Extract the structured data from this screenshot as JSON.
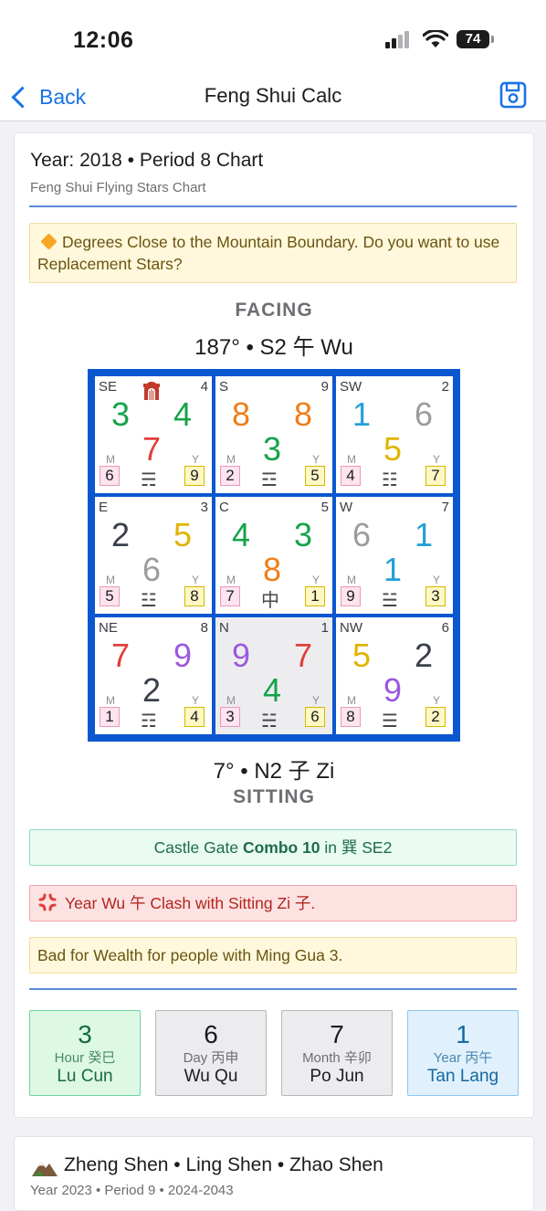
{
  "status": {
    "time": "12:06",
    "battery": "74"
  },
  "nav": {
    "back_label": "Back",
    "title": "Feng Shui Calc"
  },
  "chart": {
    "title": "Year: 2018 • Period 8 Chart",
    "subtitle": "Feng Shui Flying Stars Chart",
    "warning": "Degrees Close to the Mountain Boundary. Do you want to use Replacement Stars?",
    "facing_label": "FACING",
    "facing_direction": "187° • S2 午 Wu",
    "sitting_direction": "7° • N2 子 Zi",
    "sitting_label": "SITTING",
    "cells": [
      {
        "dir": "SE",
        "num": "4",
        "mt": "3",
        "wt": "4",
        "base": "7",
        "m_label": "M",
        "y_label": "Y",
        "m": "6",
        "y": "9",
        "trigram": "☴",
        "colors": {
          "mt": "#16a34a",
          "wt": "#16a34a",
          "base": "#e0403a"
        }
      },
      {
        "dir": "S",
        "num": "9",
        "mt": "8",
        "wt": "8",
        "base": "3",
        "m_label": "M",
        "y_label": "Y",
        "m": "2",
        "y": "5",
        "trigram": "☲",
        "colors": {
          "mt": "#ef7d1a",
          "wt": "#ef7d1a",
          "base": "#16a34a"
        }
      },
      {
        "dir": "SW",
        "num": "2",
        "mt": "1",
        "wt": "6",
        "base": "5",
        "m_label": "M",
        "y_label": "Y",
        "m": "4",
        "y": "7",
        "trigram": "☷",
        "colors": {
          "mt": "#21a0d8",
          "wt": "#9c9ca0",
          "base": "#e0b400"
        }
      },
      {
        "dir": "E",
        "num": "3",
        "mt": "2",
        "wt": "5",
        "base": "6",
        "m_label": "M",
        "y_label": "Y",
        "m": "5",
        "y": "8",
        "trigram": "☳",
        "colors": {
          "mt": "#3a3f4b",
          "wt": "#e0b400",
          "base": "#9c9ca0"
        }
      },
      {
        "dir": "C",
        "num": "5",
        "mt": "4",
        "wt": "3",
        "base": "8",
        "m_label": "M",
        "y_label": "Y",
        "m": "7",
        "y": "1",
        "trigram": "中",
        "colors": {
          "mt": "#16a34a",
          "wt": "#16a34a",
          "base": "#ef7d1a"
        }
      },
      {
        "dir": "W",
        "num": "7",
        "mt": "6",
        "wt": "1",
        "base": "1",
        "m_label": "M",
        "y_label": "Y",
        "m": "9",
        "y": "3",
        "trigram": "☱",
        "colors": {
          "mt": "#9c9ca0",
          "wt": "#21a0d8",
          "base": "#21a0d8"
        }
      },
      {
        "dir": "NE",
        "num": "8",
        "mt": "7",
        "wt": "9",
        "base": "2",
        "m_label": "M",
        "y_label": "Y",
        "m": "1",
        "y": "4",
        "trigram": "☶",
        "colors": {
          "mt": "#e0403a",
          "wt": "#9b59e0",
          "base": "#3a3f4b"
        }
      },
      {
        "dir": "N",
        "num": "1",
        "mt": "9",
        "wt": "7",
        "base": "4",
        "m_label": "M",
        "y_label": "Y",
        "m": "3",
        "y": "6",
        "trigram": "☵",
        "colors": {
          "mt": "#9b59e0",
          "wt": "#e0403a",
          "base": "#16a34a"
        }
      },
      {
        "dir": "NW",
        "num": "6",
        "mt": "5",
        "wt": "2",
        "base": "9",
        "m_label": "M",
        "y_label": "Y",
        "m": "8",
        "y": "2",
        "trigram": "☰",
        "colors": {
          "mt": "#e0b400",
          "wt": "#3a3f4b",
          "base": "#9b59e0"
        }
      }
    ],
    "castle_gate": {
      "prefix": "Castle Gate ",
      "bold": "Combo 10",
      "suffix": " in 巽 SE2"
    },
    "clash": "Year Wu 午 Clash with Sitting Zi 子.",
    "wealth": "Bad for Wealth for people with Ming Gua 3."
  },
  "pillars": [
    {
      "num": "3",
      "sub": "Hour 癸巳",
      "name": "Lu Cun"
    },
    {
      "num": "6",
      "sub": "Day 丙申",
      "name": "Wu Qu"
    },
    {
      "num": "7",
      "sub": "Month 辛卯",
      "name": "Po Jun"
    },
    {
      "num": "1",
      "sub": "Year 丙午",
      "name": "Tan Lang"
    }
  ],
  "next_card": {
    "title": "Zheng Shen • Ling Shen • Zhao Shen",
    "subtitle": "Year 2023 • Period 9 • 2024-2043"
  }
}
